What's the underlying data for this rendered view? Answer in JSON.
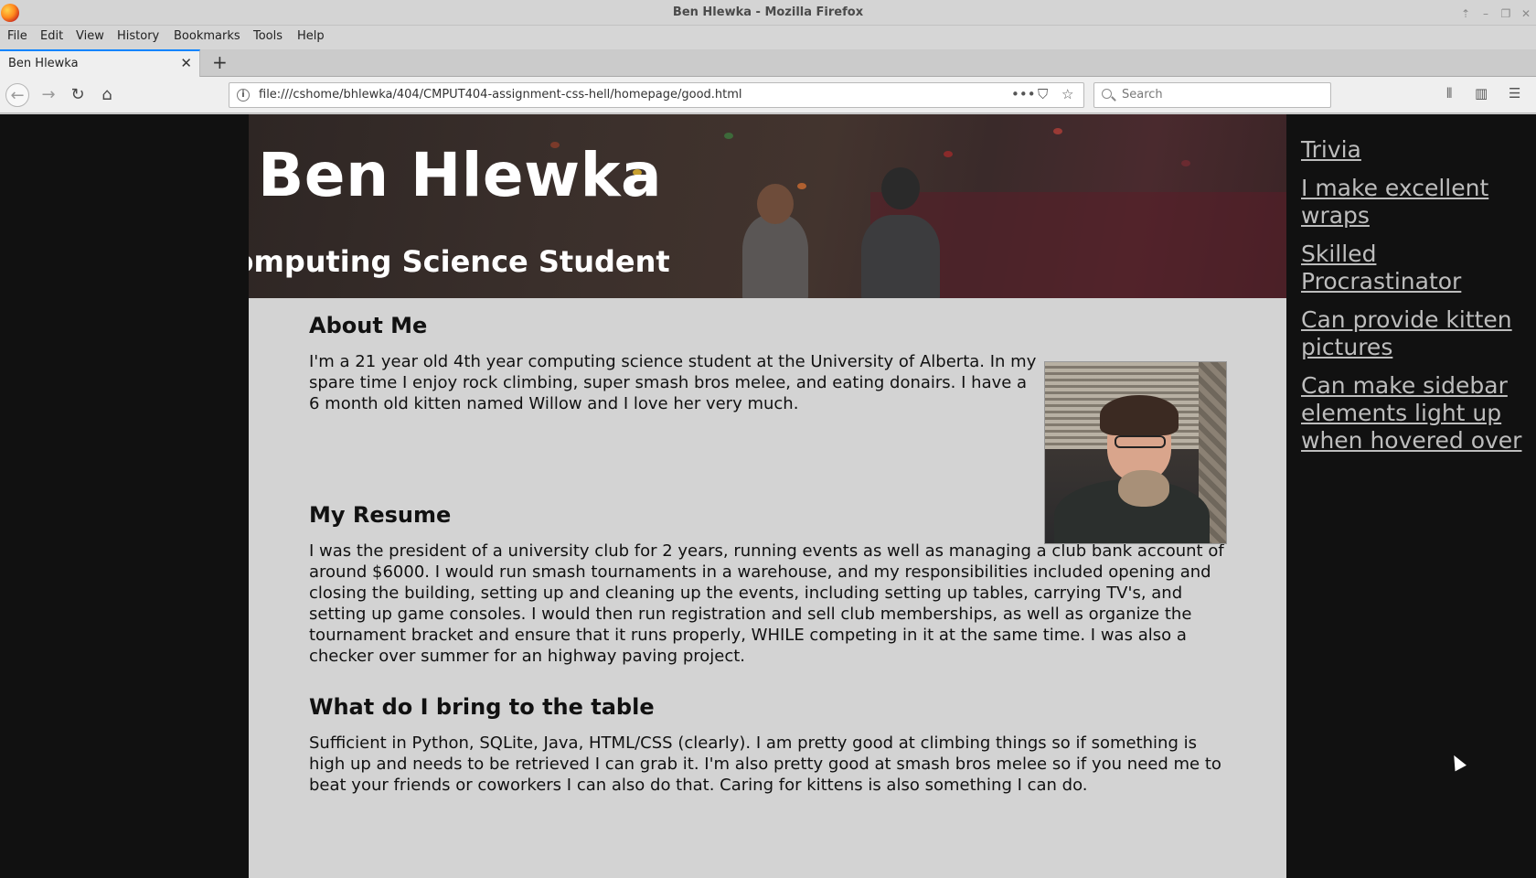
{
  "window": {
    "title": "Ben Hlewka - Mozilla Firefox"
  },
  "menubar": {
    "items": [
      "File",
      "Edit",
      "View",
      "History",
      "Bookmarks",
      "Tools",
      "Help"
    ]
  },
  "tabs": [
    {
      "label": "Ben Hlewka",
      "active": true
    }
  ],
  "navbar": {
    "url": "file:///cshome/bhlewka/404/CMPUT404-assignment-css-hell/homepage/good.html",
    "search_placeholder": "Search"
  },
  "page": {
    "header": {
      "title": "Ben Hlewka",
      "subtitle": "Computing Science Student"
    },
    "sections": {
      "about": {
        "heading": "About Me",
        "body": "I'm a 21 year old 4th year computing science student at the University of Alberta. In my spare time I enjoy rock climbing, super smash bros melee, and eating donairs. I have a 6 month old kitten named Willow and I love her very much."
      },
      "resume": {
        "heading": "My Resume",
        "body": "I was the president of a university club for 2 years, running events as well as managing a club bank account of around $6000. I would run smash tournaments in a warehouse, and my responsibilities included opening and closing the building, setting up and cleaning up the events, including setting up tables, carrying TV's, and setting up game consoles. I would then run registration and sell club memberships, as well as organize the tournament bracket and ensure that it runs properly, WHILE competing in it at the same time. I was also a checker over summer for an highway paving project."
      },
      "bring": {
        "heading": "What do I bring to the table",
        "body": "Sufficient in Python, SQLite, Java, HTML/CSS (clearly). I am pretty good at climbing things so if something is high up and needs to be retrieved I can grab it. I'm also pretty good at smash bros melee so if you need me to beat your friends or coworkers I can also do that. Caring for kittens is also something I can do."
      }
    },
    "sidebar_links": [
      "Trivia",
      "I make excellent wraps",
      "Skilled Procrastinator",
      "Can provide kitten pictures",
      "Can make sidebar elements light up when hovered over"
    ]
  },
  "colors": {
    "page_background": "#111111",
    "content_background": "#d3d3d3",
    "sidebar_link": "#bdbdbd",
    "tab_accent": "#0a84ff"
  }
}
